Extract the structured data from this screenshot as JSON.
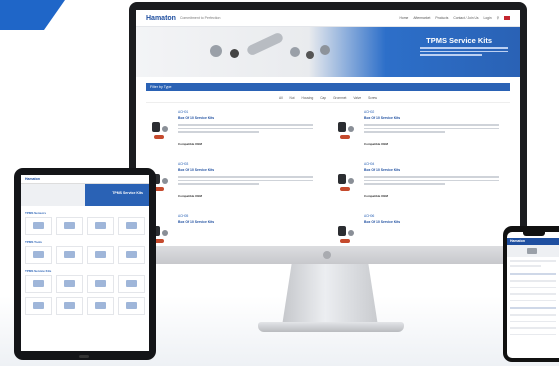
{
  "brand": {
    "logo": "Hamaton",
    "tagline": "Commitment to Perfection",
    "accent": "#2a62b5",
    "dark_accent": "#1f4fa0"
  },
  "nav": {
    "items": [
      "Home",
      "Aftermarket",
      "Products",
      "Contact / Join Us",
      "Login"
    ]
  },
  "hero": {
    "title": "TPMS Service Kits"
  },
  "filter": {
    "label": "Filter by Type",
    "tabs": [
      "All",
      "Nut",
      "Housing",
      "Cap",
      "Grommet",
      "Valve",
      "Screw"
    ]
  },
  "products": [
    {
      "code": "ACH01",
      "name": "Box Of 10 Service Kits",
      "comp": "Compatible OEM"
    },
    {
      "code": "ACH02",
      "name": "Box Of 10 Service Kits",
      "comp": "Compatible OEM"
    },
    {
      "code": "ACH03",
      "name": "Box Of 10 Service Kits",
      "comp": "Compatible OEM"
    },
    {
      "code": "ACH04",
      "name": "Box Of 10 Service Kits",
      "comp": "Compatible OEM"
    },
    {
      "code": "ACH05",
      "name": "Box Of 10 Service Kits",
      "comp": ""
    },
    {
      "code": "ACH06",
      "name": "Box Of 10 Service Kits",
      "comp": ""
    }
  ],
  "tablet": {
    "logo": "Hamaton",
    "hero_title": "TPMS Service Kits",
    "sections": [
      "TPMS Sensors",
      "TPMS Tools",
      "TPMS Service Kits"
    ]
  },
  "phone": {
    "logo": "Hamaton"
  }
}
